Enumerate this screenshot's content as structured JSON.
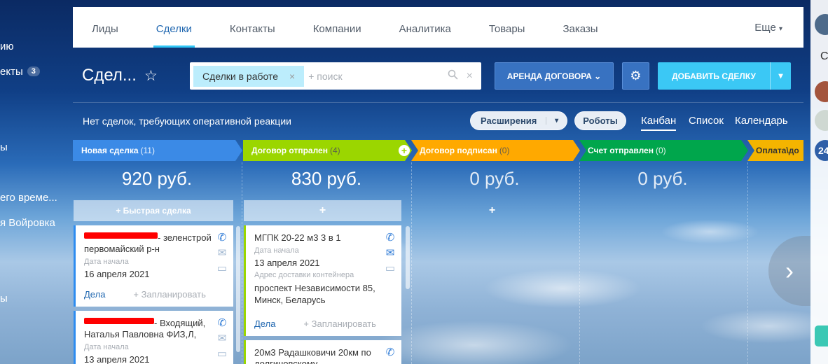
{
  "left_menu": {
    "items": [
      {
        "label": "ию"
      },
      {
        "label": "екты",
        "badge": "3"
      },
      {
        "label": "ы"
      },
      {
        "label": "его време..."
      },
      {
        "label": "я Войровка"
      },
      {
        "label": "ы"
      }
    ]
  },
  "nav": {
    "items": [
      "Лиды",
      "Сделки",
      "Контакты",
      "Компании",
      "Аналитика",
      "Товары",
      "Заказы"
    ],
    "active": "Сделки",
    "more": "Еще"
  },
  "header": {
    "title": "Сдел...",
    "filter_tag": "Сделки в работе",
    "search_placeholder": "+ поиск",
    "arenda_button": "АРЕНДА ДОГОВОРА",
    "add_button": "ДОБАВИТЬ СДЕЛКУ"
  },
  "toolbar": {
    "no_deals": "Нет сделок, требующих оперативной реакции",
    "extensions": "Расширения",
    "robots": "Роботы",
    "views": [
      "Канбан",
      "Список",
      "Календарь"
    ],
    "active_view": "Канбан"
  },
  "stages": [
    {
      "name": "Новая сделка",
      "count": "(11)",
      "color": "#3b8ae6",
      "sum": "920 руб.",
      "quick": "+ Быстрая сделка"
    },
    {
      "name": "Договор отпрален",
      "count": "(4)",
      "color": "#9bd600",
      "sum": "830 руб.",
      "quick": "+"
    },
    {
      "name": "Договор подписан",
      "count": "(0)",
      "color": "#ffa900",
      "sum": "0 руб.",
      "quick": "+"
    },
    {
      "name": "Счет отправлен",
      "count": "(0)",
      "color": "#00a64c",
      "sum": "0 руб.",
      "quick": ""
    },
    {
      "name": "Оплата\\до",
      "count": "",
      "color": "#f4b400",
      "sum": "",
      "quick": ""
    }
  ],
  "cards": {
    "c1": {
      "title_tail": "- зеленстрой первомайский р-н",
      "date_label": "Дата начала",
      "date": "16 апреля 2021",
      "deals": "Дела",
      "plan": "+ Запланировать"
    },
    "c2": {
      "title_tail": "- Входящий, Наталья Павловна ФИЗ,Л,",
      "date_label": "Дата начала",
      "date": "13 апреля 2021"
    },
    "c3": {
      "title": "МГПК 20-22 м3 3 в 1",
      "date_label": "Дата начала",
      "date": "13 апреля 2021",
      "addr_label": "Адрес доставки контейнера",
      "addr": "проспект Независимости 85, Минск, Беларусь",
      "deals": "Дела",
      "plan": "+ Запланировать"
    },
    "c4": {
      "title": "20м3 Радашковичи 20км по долгиновскому"
    }
  },
  "right_bar": {
    "c": "С",
    "counter": "24"
  }
}
